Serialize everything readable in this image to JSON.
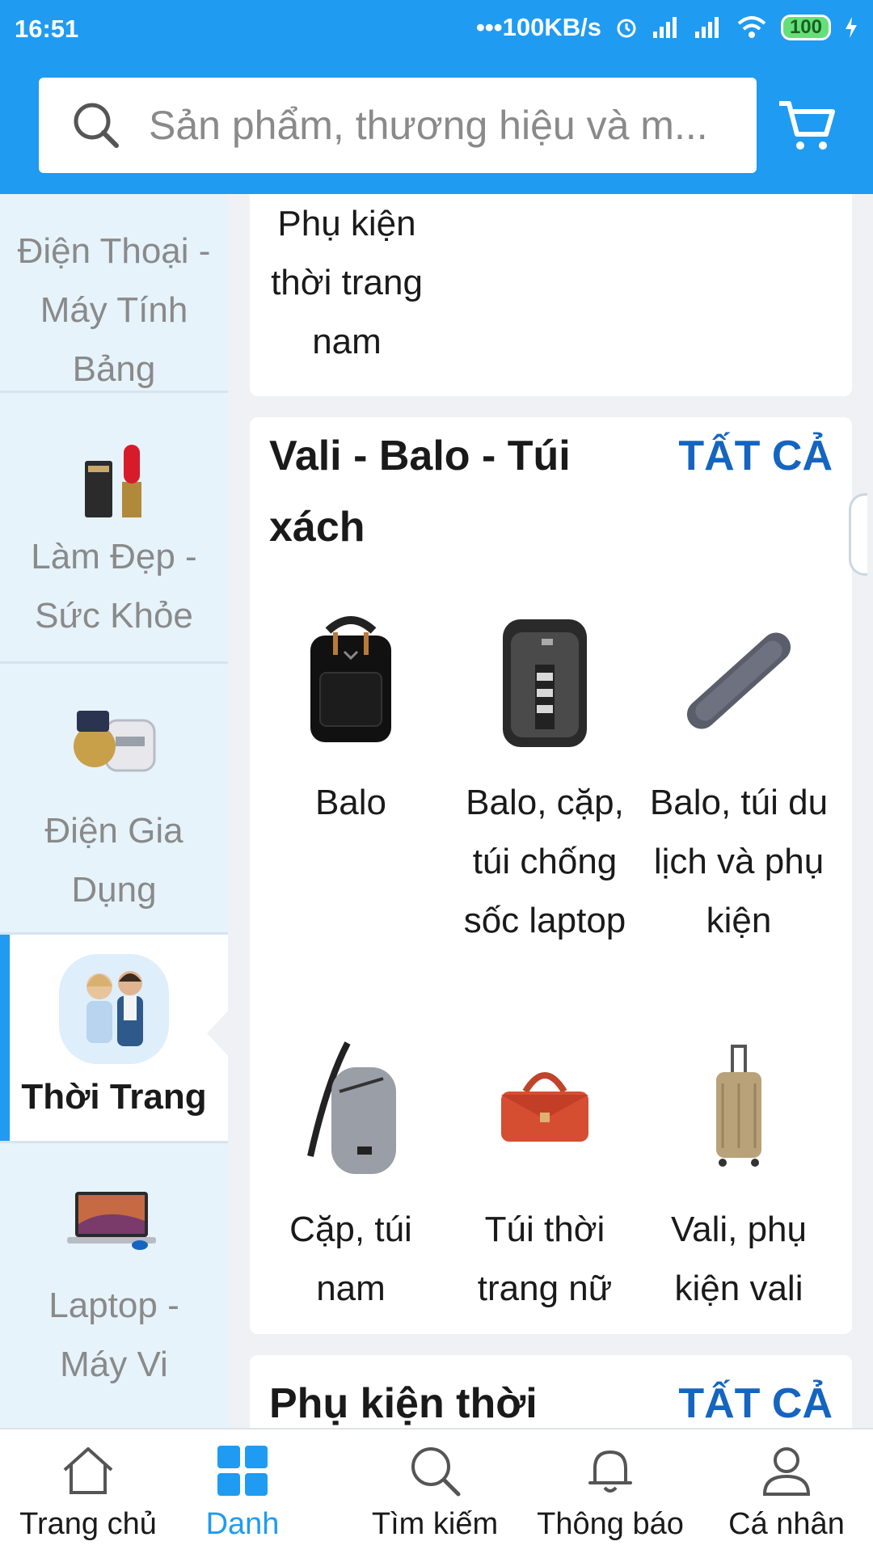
{
  "status": {
    "time": "16:51",
    "speed": "•••100KB/s",
    "battery": "100"
  },
  "search": {
    "placeholder": "Sản phẩm, thương hiệu và m..."
  },
  "sidebar": {
    "items": [
      {
        "label": "Điện Thoại - Máy Tính Bảng",
        "icon": "phone-icon"
      },
      {
        "label": "Làm Đẹp - Sức Khỏe",
        "icon": "cosmetics-icon"
      },
      {
        "label": "Điện Gia Dụng",
        "icon": "appliance-icon"
      },
      {
        "label": "Thời Trang",
        "icon": "fashion-icon",
        "active": true
      },
      {
        "label": "Laptop - Máy Vi",
        "icon": "laptop-icon"
      }
    ]
  },
  "main": {
    "top_partial": {
      "label": "Phụ kiện thời trang nam"
    },
    "section": {
      "title": "Vali - Balo - Túi xách",
      "all_label": "TẤT CẢ",
      "items": [
        {
          "label": "Balo",
          "icon": "backpack-icon"
        },
        {
          "label": "Balo, cặp, túi chống sốc laptop",
          "icon": "laptop-backpack-icon"
        },
        {
          "label": "Balo, túi du lịch và phụ kiện",
          "icon": "travel-case-icon"
        },
        {
          "label": "Cặp, túi nam",
          "icon": "sling-bag-icon"
        },
        {
          "label": "Túi thời trang nữ",
          "icon": "handbag-icon"
        },
        {
          "label": "Vali, phụ kiện vali",
          "icon": "suitcase-icon"
        }
      ]
    },
    "next_section": {
      "title": "Phụ kiện thời",
      "all_label": "TẤT CẢ"
    }
  },
  "nav": {
    "items": [
      {
        "label": "Trang chủ",
        "icon": "home-icon"
      },
      {
        "label": "Danh",
        "icon": "grid-icon",
        "active": true
      },
      {
        "label": "Tìm kiếm",
        "icon": "search-icon"
      },
      {
        "label": "Thông báo",
        "icon": "bell-icon"
      },
      {
        "label": "Cá nhân",
        "icon": "user-icon"
      }
    ]
  },
  "colors": {
    "brand": "#1f9bf2",
    "link": "#1565c0"
  }
}
